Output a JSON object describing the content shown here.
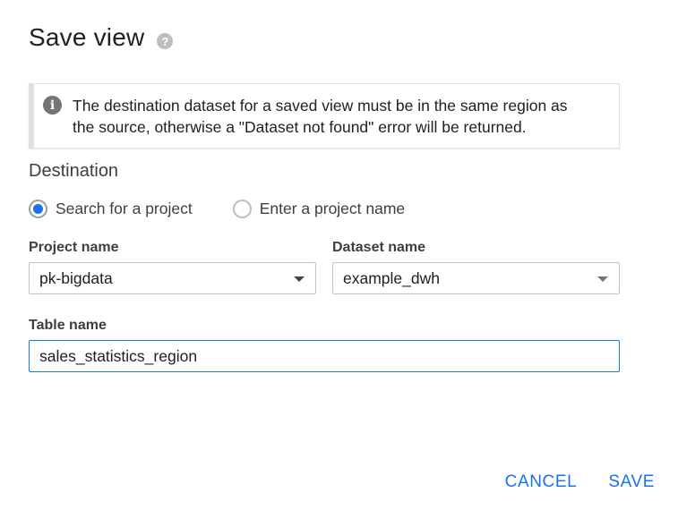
{
  "dialog": {
    "title": "Save view",
    "help_icon": "help-circle-icon"
  },
  "info_banner": {
    "icon": "info-icon",
    "icon_glyph": "i",
    "line1": "The destination dataset for a saved view must be in the same region as",
    "line2": "the source, otherwise a \"Dataset not found\" error will be returned."
  },
  "destination": {
    "heading": "Destination",
    "options": [
      {
        "label": "Search for a project",
        "selected": true
      },
      {
        "label": "Enter a project name",
        "selected": false
      }
    ]
  },
  "fields": {
    "project": {
      "label": "Project name",
      "value": "pk-bigdata"
    },
    "dataset": {
      "label": "Dataset name",
      "value": "example_dwh"
    },
    "table": {
      "label": "Table name",
      "value": "sales_statistics_region"
    }
  },
  "actions": {
    "cancel": "CANCEL",
    "save": "SAVE"
  },
  "colors": {
    "accent": "#1a73e8",
    "banner_border": "#e0e0e0"
  }
}
